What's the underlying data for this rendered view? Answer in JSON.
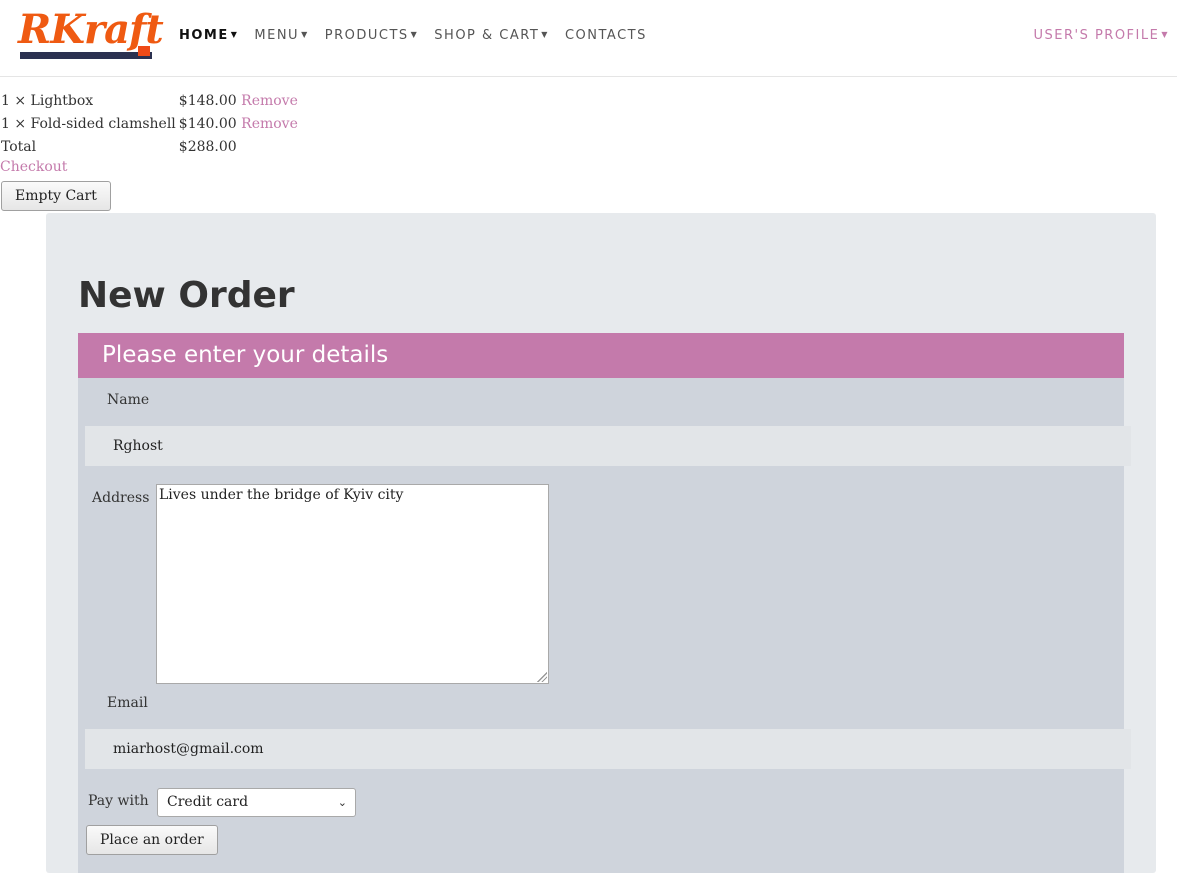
{
  "brand": {
    "logo_text": "RKraft",
    "logo_colors": {
      "text": "#ef5a12",
      "bar": "#2b3150",
      "accent": "#ef4a17"
    }
  },
  "nav": {
    "items": [
      {
        "label": "HOME",
        "caret": true
      },
      {
        "label": "MENU",
        "caret": true
      },
      {
        "label": "PRODUCTS",
        "caret": true
      },
      {
        "label": "SHOP & CART",
        "caret": true
      },
      {
        "label": "CONTACTS",
        "caret": false
      }
    ],
    "user_profile": "USER'S PROFILE"
  },
  "cart": {
    "items": [
      {
        "qty_name": "1 × Lightbox",
        "price": "$148.00",
        "remove": "Remove"
      },
      {
        "qty_name": "1 × Fold-sided clamshell",
        "price": "$140.00",
        "remove": "Remove"
      }
    ],
    "total_label": "Total",
    "total_value": "$288.00",
    "checkout_link": "Checkout",
    "empty_cart_button": "Empty Cart"
  },
  "order": {
    "title": "New Order",
    "header": "Please enter your details",
    "name_label": "Name",
    "name_value": "Rghost",
    "address_label": "Address",
    "address_value": "Lives under the bridge of Kyiv city",
    "email_label": "Email",
    "email_value": "miarhost@gmail.com",
    "pay_label": "Pay with",
    "pay_value": "Credit card",
    "submit_button": "Place an order"
  },
  "colors": {
    "accent": "#c47aab",
    "panel_bg": "#e7eaed",
    "form_bg": "#cfd4dc"
  }
}
